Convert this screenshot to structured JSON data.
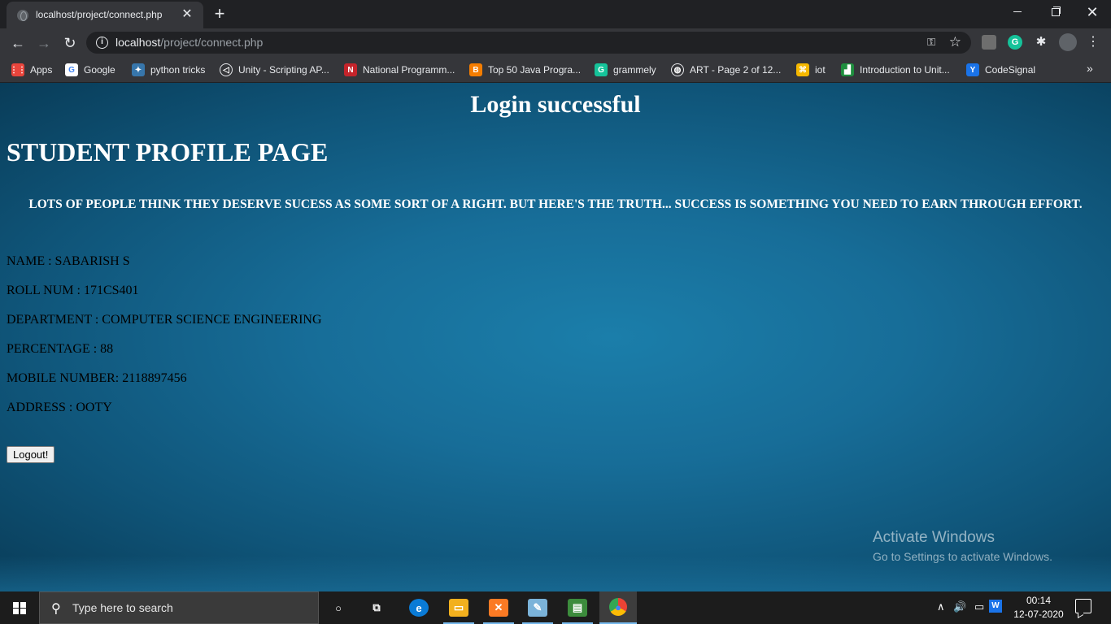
{
  "browser": {
    "tab": {
      "title": "localhost/project/connect.php",
      "close": "✕"
    },
    "new_tab": "+",
    "window": {
      "minimize": "",
      "maximize": "",
      "close": "✕"
    },
    "nav": {
      "back": "←",
      "forward": "→",
      "reload": "↻"
    },
    "address": {
      "host": "localhost",
      "path": "/project/connect.php"
    },
    "extensions": {
      "grammarly": "G"
    },
    "bookmarks": [
      {
        "label": "Apps",
        "icon": "apps-grid-icon",
        "color": "#e8453c"
      },
      {
        "label": "Google",
        "icon": "google-icon",
        "color": "#ffffff"
      },
      {
        "label": "python tricks",
        "icon": "python-icon",
        "color": "#3776ab"
      },
      {
        "label": "Unity - Scripting AP...",
        "icon": "unity-icon",
        "color": "#35363a"
      },
      {
        "label": "National Programm...",
        "icon": "n-icon",
        "color": "#c4242b"
      },
      {
        "label": "Top 50 Java Progra...",
        "icon": "blogger-icon",
        "color": "#f57d00"
      },
      {
        "label": "grammely",
        "icon": "grammarly-icon",
        "color": "#15c39a"
      },
      {
        "label": "ART - Page 2 of 12...",
        "icon": "globe-icon",
        "color": "#35363a"
      },
      {
        "label": "iot",
        "icon": "iot-icon",
        "color": "#f5b800"
      },
      {
        "label": "Introduction to Unit...",
        "icon": "chart-icon",
        "color": "#1e8e3e"
      },
      {
        "label": "CodeSignal",
        "icon": "codesignal-icon",
        "color": "#1a73e8"
      }
    ],
    "bookmarks_more": "»"
  },
  "page": {
    "login_message": "Login successful",
    "title": "STUDENT PROFILE PAGE",
    "quote": "LOTS OF PEOPLE THINK THEY DESERVE SUCESS AS SOME SORT OF A RIGHT. BUT HERE'S THE TRUTH... SUCCESS IS SOMETHING YOU NEED TO EARN THROUGH EFFORT.",
    "fields": [
      "NAME : SABARISH S",
      "ROLL NUM : 171CS401",
      "DEPARTMENT : COMPUTER SCIENCE ENGINEERING",
      "PERCENTAGE : 88",
      "MOBILE NUMBER: 2118897456",
      "ADDRESS : OOTY"
    ],
    "logout_label": "Logout!",
    "background_color": "#176d98"
  },
  "watermark": {
    "title": "Activate Windows",
    "subtitle": "Go to Settings to activate Windows."
  },
  "taskbar": {
    "search_placeholder": "Type here to search",
    "apps": [
      {
        "name": "cortana-icon",
        "glyph": "○"
      },
      {
        "name": "task-view-icon",
        "glyph": "⧉"
      },
      {
        "name": "edge-icon",
        "glyph": "e"
      },
      {
        "name": "file-explorer-icon",
        "glyph": "▭"
      },
      {
        "name": "xampp-icon",
        "glyph": "✕"
      },
      {
        "name": "notepad-icon",
        "glyph": "✎"
      },
      {
        "name": "sticky-chart-icon",
        "glyph": "▤"
      },
      {
        "name": "chrome-icon",
        "glyph": "●"
      }
    ],
    "tray": {
      "up_arrow": "∧",
      "volume": "🔊",
      "battery": "▭",
      "input": "W"
    },
    "clock": {
      "time": "00:14",
      "date": "12-07-2020"
    }
  }
}
